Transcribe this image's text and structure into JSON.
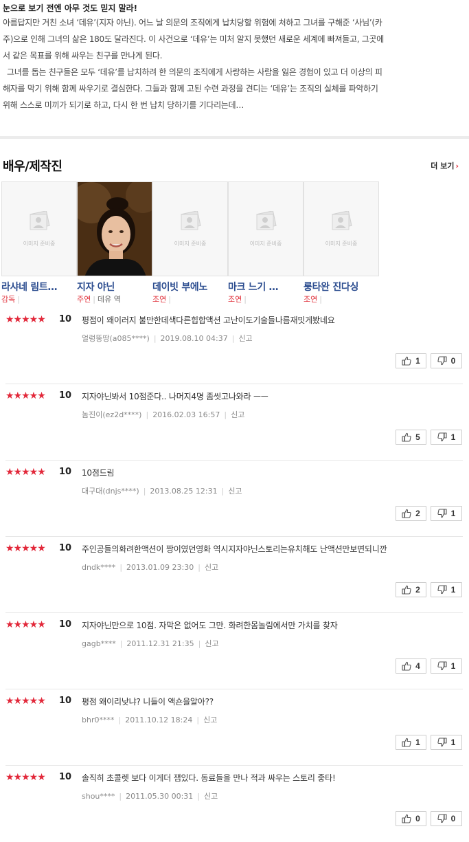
{
  "synopsis": {
    "title": "눈으로 보기 전엔 아무 것도 믿지 말라!",
    "lines": [
      "아름답지만 거친 소녀 ‘데유’(지자 야닌). 어느 날 의문의 조직에게 납치당할 위험에 처하고 그녀를 구해준 ‘사님’(카",
      "주)으로 인해 그녀의 삶은 180도 달라진다. 이 사건으로 ‘데유’는 미처 알지 못했던 새로운 세계에 빠져들고, 그곳에",
      "서 같은 목표를 위해 싸우는 친구를 만나게 된다.",
      "그녀를 돕는 친구들은 모두 ‘데유’를 납치하려 한 의문의 조직에게 사랑하는 사람을 잃은 경험이 있고 더 이상의 피",
      "해자를 막기 위해 함께 싸우기로 결심한다. 그들과 함께 고된 수련 과정을 견디는 ‘데유’는 조직의 실체를 파악하기",
      "위해 스스로 미끼가 되기로 하고, 다시 한 번 납치 당하기를 기다리는데…"
    ]
  },
  "cast_section": {
    "title": "배우/제작진",
    "more_label": "더 보기",
    "placeholder_text": "이미지 준비중",
    "members": [
      {
        "name": "라샤네 림트…",
        "role": "감독",
        "character": "",
        "has_photo": false
      },
      {
        "name": "지자 야닌",
        "role": "주연",
        "character": "데유 역",
        "has_photo": true
      },
      {
        "name": "데이빗 부에노",
        "role": "조연",
        "character": "",
        "has_photo": false
      },
      {
        "name": "마크 느기 …",
        "role": "조연",
        "character": "",
        "has_photo": false
      },
      {
        "name": "룽타완 진다싱",
        "role": "조연",
        "character": "",
        "has_photo": false
      }
    ]
  },
  "reviews": [
    {
      "stars": "★★★★★",
      "score": "10",
      "comment": "평점이 왜이러지 불만한데색다른힙합액션 고난이도기술들나름재밋게봤네요",
      "user": "얼렁뚱땅(a085****)",
      "date": "2019.08.10 04:37",
      "report": "신고",
      "likes": "1",
      "dislikes": "0"
    },
    {
      "stars": "★★★★★",
      "score": "10",
      "comment": "지자야닌봐서 10점준다.. 나머지4명 좀씻고나와라 ㅡㅡ",
      "user": "놈진이(ez2d****)",
      "date": "2016.02.03 16:57",
      "report": "신고",
      "likes": "5",
      "dislikes": "1"
    },
    {
      "stars": "★★★★★",
      "score": "10",
      "comment": "10점드림",
      "user": "대구대(dnjs****)",
      "date": "2013.08.25 12:31",
      "report": "신고",
      "likes": "2",
      "dislikes": "1"
    },
    {
      "stars": "★★★★★",
      "score": "10",
      "comment": "주인공들의화려한액션이 짱이였던영화 역시지자야닌스토리는유치해도 난액션만보면되니깐",
      "user": "dndk****",
      "date": "2013.01.09 23:30",
      "report": "신고",
      "likes": "2",
      "dislikes": "1"
    },
    {
      "stars": "★★★★★",
      "score": "10",
      "comment": "지자야닌만으로 10점. 자막은 없어도 그만. 화려한몸놀림에서만 가치를 찾자",
      "user": "gagb****",
      "date": "2011.12.31 21:35",
      "report": "신고",
      "likes": "4",
      "dislikes": "1"
    },
    {
      "stars": "★★★★★",
      "score": "10",
      "comment": "평점 왜이리낮냐? 니들이 액숀을알아??",
      "user": "bhr0****",
      "date": "2011.10.12 18:24",
      "report": "신고",
      "likes": "1",
      "dislikes": "1"
    },
    {
      "stars": "★★★★★",
      "score": "10",
      "comment": "솔직히 초콜렛 보다 이게더 잼있다. 동료들을 만나 적과 싸우는 스토리 좋타!",
      "user": "shou****",
      "date": "2011.05.30 00:31",
      "report": "신고",
      "likes": "0",
      "dislikes": "0"
    }
  ],
  "colors": {
    "accent": "#e2283a",
    "link": "#2b4c8f"
  }
}
